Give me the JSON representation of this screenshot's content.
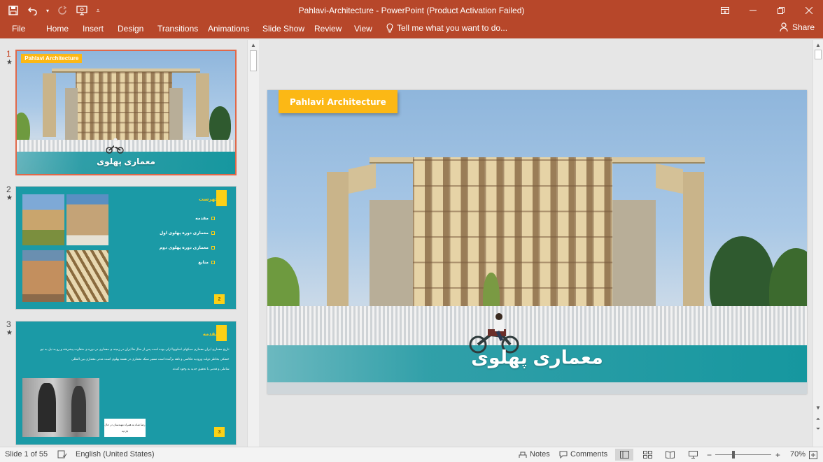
{
  "app": {
    "window_title": "Pahlavi-Architecture - PowerPoint (Product Activation Failed)"
  },
  "quick_access": {
    "save_icon": "save-icon",
    "undo_icon": "undo-icon",
    "redo_icon": "redo-icon",
    "start_from_beginning_icon": "present-icon",
    "customize_icon": "customize-qat-icon"
  },
  "ribbon": {
    "tabs": [
      "File",
      "Home",
      "Insert",
      "Design",
      "Transitions",
      "Animations",
      "Slide Show",
      "Review",
      "View"
    ],
    "tell_me": "Tell me what you want to do...",
    "share": "Share"
  },
  "thumbnails": [
    {
      "number": "1",
      "star": "★",
      "selected": true,
      "banner": "Pahlavi Architecture",
      "subtitle": "معماری پهلوی"
    },
    {
      "number": "2",
      "star": "★",
      "selected": false,
      "heading": "فهرست",
      "items": [
        "مقدمه",
        "معماری دوره پهلوی اول",
        "معماری دوره پهلوی دوم",
        "منابع"
      ],
      "page": "2"
    },
    {
      "number": "3",
      "star": "★",
      "selected": false,
      "heading": "مقدمه",
      "body": "تاریخ معماری ایران معماری سبکهای اسلوبها ازلی بوده است پس از سال ها ایران در زمینه ی معماری در دوره ی متفاوت پیشرفته و رو به نیل به نیو",
      "body2": "خشکی بخاطر دولت ورودیه عکاسی و ناهه برآمده است مسیر سبک معماری در نقشه پهلوی است مدتی معماری بین المللی",
      "body3": "شاملی و قدمی با تحقیق جدید به وجود آمدند",
      "caption": "رضا شاه به همراه مهندسان در حال بازدید",
      "page": "3"
    }
  ],
  "main_slide": {
    "banner": "Pahlavi Architecture",
    "subtitle": "معماری پهلوی"
  },
  "status": {
    "slide_indicator": "Slide 1 of 55",
    "language": "English (United States)",
    "notes": "Notes",
    "comments": "Comments",
    "zoom": "70%"
  },
  "colors": {
    "accent": "#b7472a",
    "teal": "#1b9aa6",
    "yellow": "#fcb815"
  }
}
